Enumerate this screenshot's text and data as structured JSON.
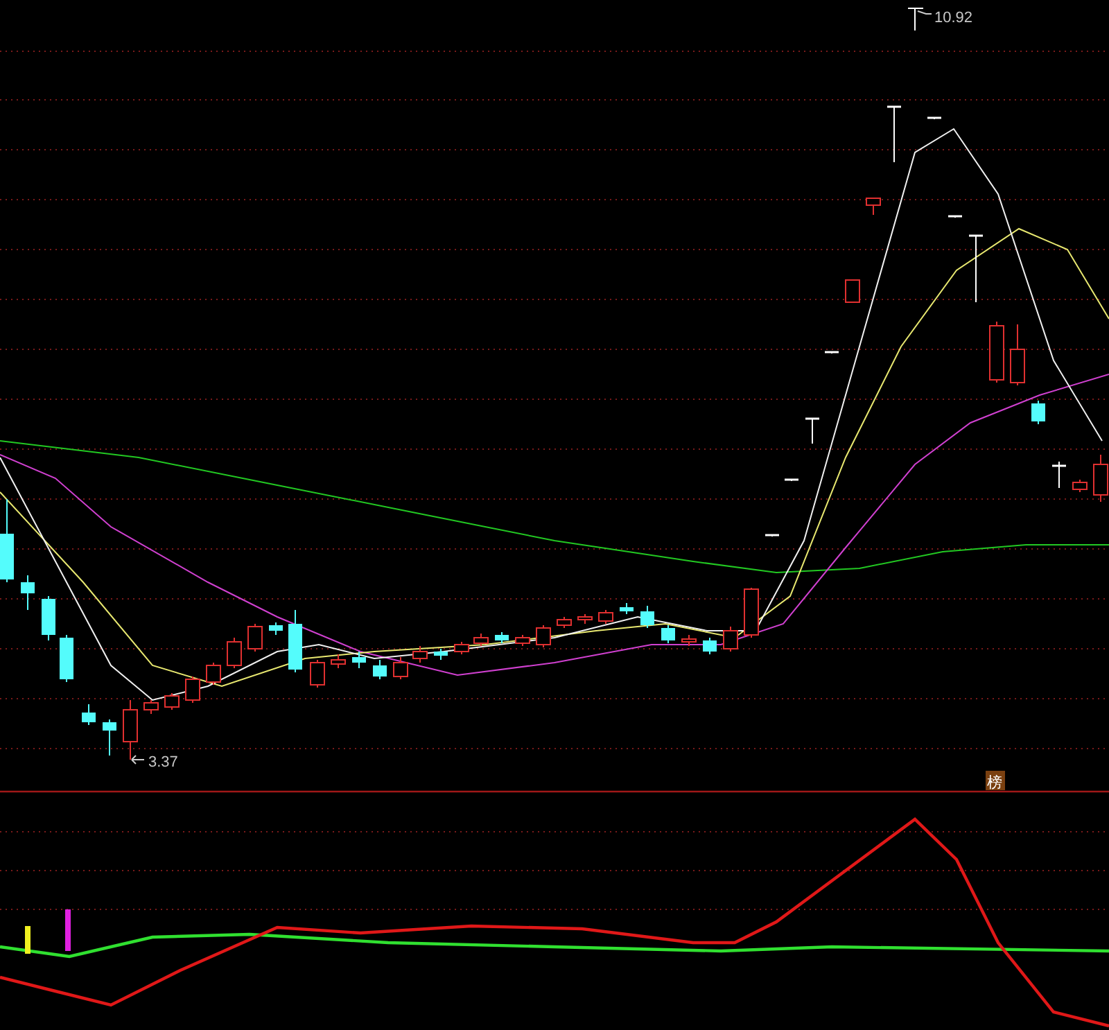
{
  "price_chart": {
    "high_label": "10.92",
    "low_label": "3.37"
  },
  "indicator_panel": {
    "tag": "榜"
  }
}
